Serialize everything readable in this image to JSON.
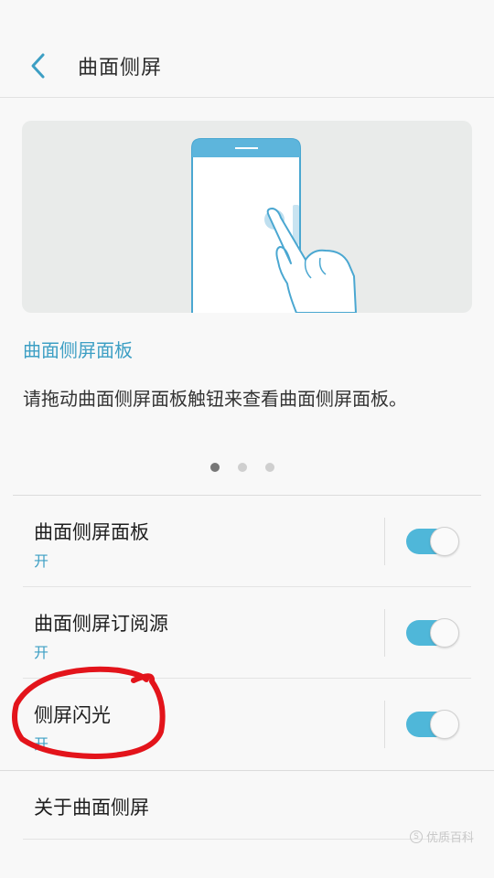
{
  "header": {
    "title": "曲面侧屏",
    "back_icon": "chevron-left-icon"
  },
  "intro": {
    "panel_title": "曲面侧屏面板",
    "description": "请拖动曲面侧屏面板触钮来查看曲面侧屏面板。",
    "page_count": 3,
    "active_page": 1
  },
  "settings": [
    {
      "label": "曲面侧屏面板",
      "status": "开",
      "enabled": true
    },
    {
      "label": "曲面侧屏订阅源",
      "status": "开",
      "enabled": true
    },
    {
      "label": "侧屏闪光",
      "status": "开",
      "enabled": true
    }
  ],
  "about": {
    "label": "关于曲面侧屏"
  },
  "watermark": {
    "text": "优质百科"
  },
  "colors": {
    "accent": "#3d9fc4",
    "toggle_on": "#4fb7d9",
    "annotation_red": "#e3141b"
  }
}
